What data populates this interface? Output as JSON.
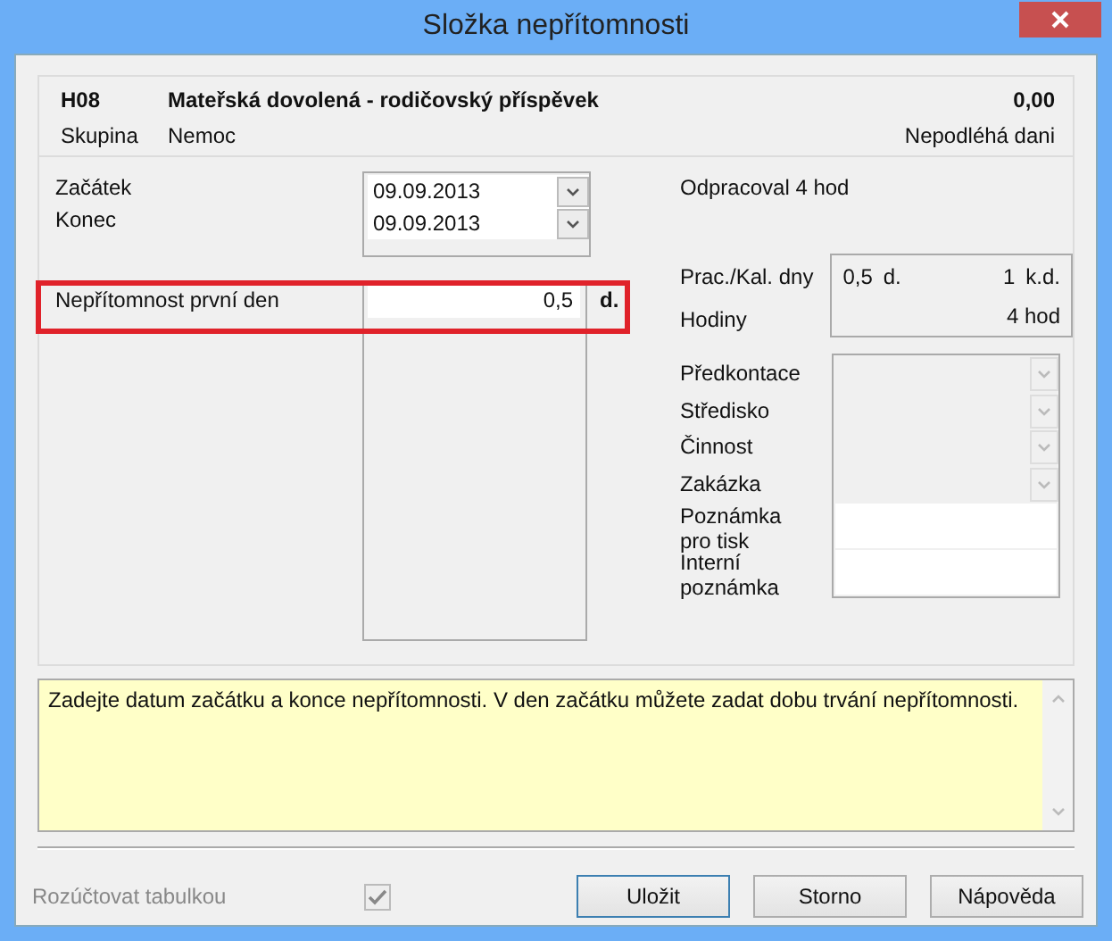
{
  "window": {
    "title": "Složka nepřítomnosti"
  },
  "header": {
    "code": "H08",
    "name": "Mateřská dovolená - rodičovský příspěvek",
    "amount": "0,00",
    "group_label": "Skupina",
    "group": "Nemoc",
    "tax": "Nepodléhá dani"
  },
  "dates": [
    {
      "label": "Začátek",
      "value": "09.09.2013"
    },
    {
      "label": "Konec",
      "value": "09.09.2013"
    }
  ],
  "worked": "Odpracoval 4 hod",
  "first_day": {
    "label": "Nepřítomnost první den",
    "value": "0,5",
    "unit": "d.",
    "highlighted": true
  },
  "summary": {
    "days_label": "Prac./Kal. dny",
    "work_days": "0,5",
    "work_unit": "d.",
    "cal_days": "1",
    "cal_unit": "k.d.",
    "hours_label": "Hodiny",
    "hours": "4 hod"
  },
  "fields": [
    {
      "kind": "dropdown",
      "label": "Předkontace",
      "disabled": true
    },
    {
      "kind": "dropdown",
      "label": "Středisko",
      "disabled": true
    },
    {
      "kind": "dropdown",
      "label": "Činnost",
      "disabled": true
    },
    {
      "kind": "dropdown",
      "label": "Zakázka",
      "disabled": true
    },
    {
      "kind": "note",
      "label": "Poznámka\npro tisk"
    },
    {
      "kind": "note",
      "label": "Interní\npoznámka"
    }
  ],
  "hint": "Zadejte datum začátku a konce nepřítomnosti. V den začátku můžete zadat dobu trvání nepřítomnosti.",
  "split_checkbox": {
    "label": "Rozúčtovat tabulkou",
    "checked": true,
    "disabled": true
  },
  "buttons": [
    {
      "label": "Uložit",
      "default": true
    },
    {
      "label": "Storno",
      "default": false
    },
    {
      "label": "Nápověda",
      "default": false
    }
  ]
}
